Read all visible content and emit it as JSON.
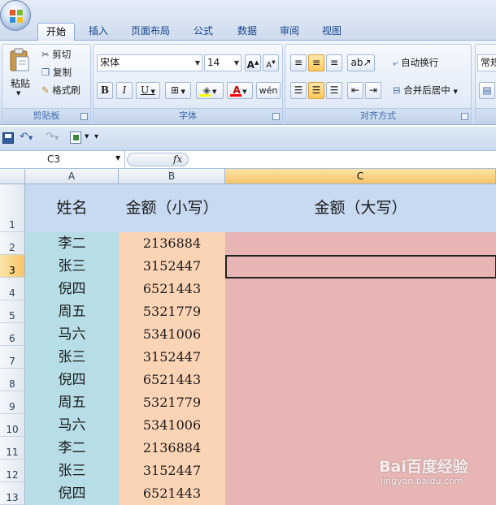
{
  "ribbon": {
    "tabs": [
      "开始",
      "插入",
      "页面布局",
      "公式",
      "数据",
      "审阅",
      "视图"
    ],
    "active_tab": "开始",
    "clipboard": {
      "paste": "粘贴",
      "cut": "剪切",
      "copy": "复制",
      "format_painter": "格式刷",
      "group_label": "剪贴板"
    },
    "font": {
      "name": "宋体",
      "size": "14",
      "bold": "B",
      "italic": "I",
      "underline": "U",
      "font_color_glyph": "A",
      "group_label": "字体"
    },
    "alignment": {
      "wrap_text": "自动换行",
      "merge_center": "合并后居中",
      "group_label": "对齐方式"
    },
    "number": {
      "format": "常规"
    }
  },
  "formula_bar": {
    "name_box": "C3",
    "fx": "fx",
    "content": ""
  },
  "sheet": {
    "columns": [
      "A",
      "B",
      "C"
    ],
    "selected_column": "C",
    "selected_row": 3,
    "active_cell": "C3",
    "header_row": {
      "name": "姓名",
      "amount_small": "金额（小写）",
      "amount_large": "金额（大写）"
    },
    "rows": [
      {
        "row": "2",
        "name": "李二",
        "amount": "2136884"
      },
      {
        "row": "3",
        "name": "张三",
        "amount": "3152447"
      },
      {
        "row": "4",
        "name": "倪四",
        "amount": "6521443"
      },
      {
        "row": "5",
        "name": "周五",
        "amount": "5321779"
      },
      {
        "row": "6",
        "name": "马六",
        "amount": "5341006"
      },
      {
        "row": "7",
        "name": "张三",
        "amount": "3152447"
      },
      {
        "row": "8",
        "name": "倪四",
        "amount": "6521443"
      },
      {
        "row": "9",
        "name": "周五",
        "amount": "5321779"
      },
      {
        "row": "10",
        "name": "马六",
        "amount": "5341006"
      },
      {
        "row": "11",
        "name": "李二",
        "amount": "2136884"
      },
      {
        "row": "12",
        "name": "张三",
        "amount": "3152447"
      },
      {
        "row": "13",
        "name": "倪四",
        "amount": "6521443"
      }
    ]
  },
  "watermark": {
    "brand": "Bai百度经验",
    "url": "jingyan.baidu.com"
  },
  "colors": {
    "col_a_fill": "#b7dde6",
    "col_b_fill": "#fbd3b5",
    "col_c_fill": "#e6b5b4",
    "header_fill": "#c7daf1",
    "selection_accent": "#f7c46a"
  }
}
